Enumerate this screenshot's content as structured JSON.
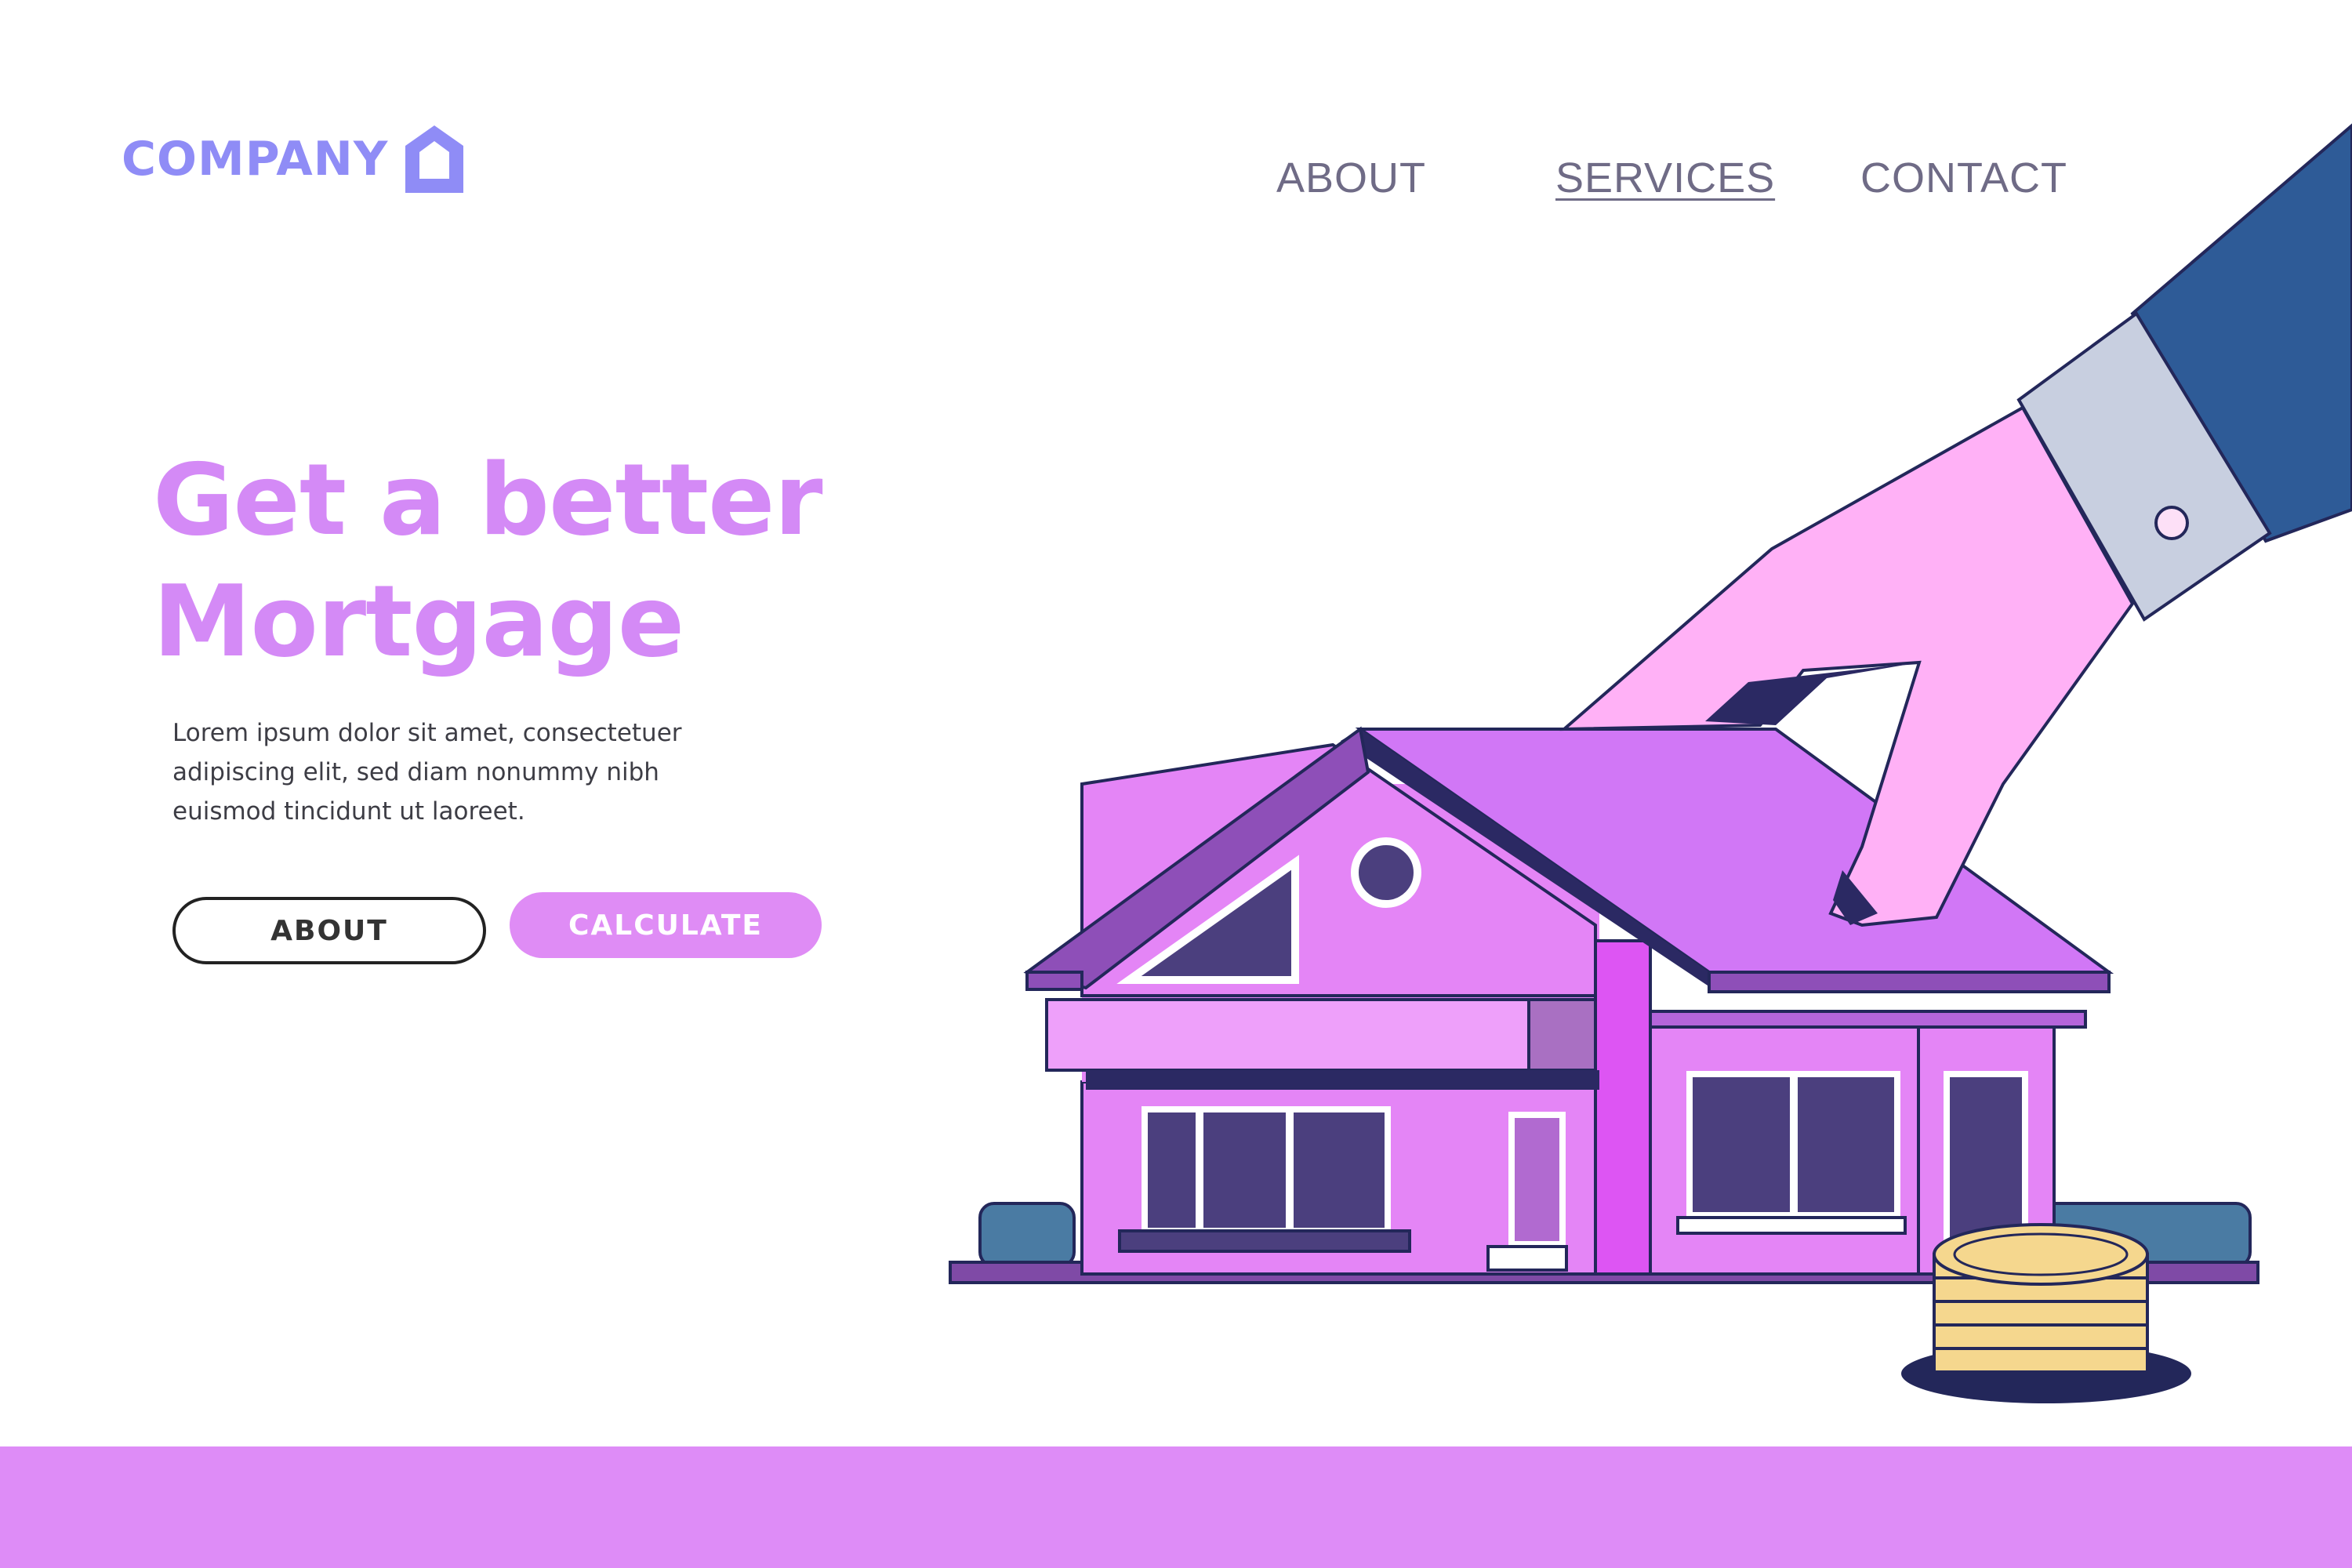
{
  "header": {
    "logo_text": "COMPANY",
    "nav": {
      "about": "ABOUT",
      "services": "SERVICES",
      "contact": "CONTACT"
    }
  },
  "hero": {
    "headline_line1": "Get a better",
    "headline_line2": "Mortgage",
    "body_line1": "Lorem ipsum dolor sit amet, consectetuer",
    "body_line2": "adipiscing elit, sed diam nonummy nibh",
    "body_line3": "euismod tincidunt ut laoreet.",
    "about_button": "ABOUT",
    "calculate_button": "CALCULATE"
  },
  "colors": {
    "logo": "#8f8cf6",
    "headline": "#d48af6",
    "accent_button": "#df8cf5",
    "footer_bar": "#de8cf7",
    "nav_text": "#6f6b86"
  },
  "icons": {
    "logo": "house-outline-icon"
  }
}
